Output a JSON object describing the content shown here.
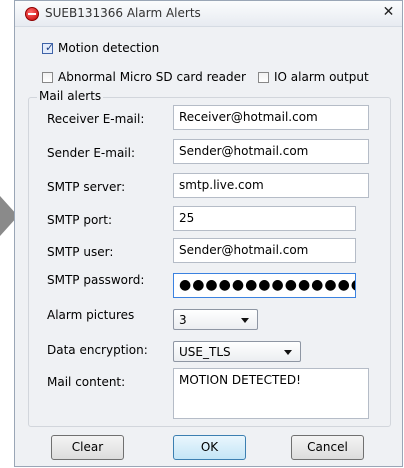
{
  "window": {
    "title": "SUEB131366 Alarm Alerts",
    "close_glyph": "✕"
  },
  "options": {
    "motion_detection": {
      "label": "Motion detection",
      "checked": true
    },
    "sd_card_reader": {
      "label": "Abnormal Micro SD card reader",
      "checked": false
    },
    "io_alarm_output": {
      "label": "IO alarm output",
      "checked": false
    }
  },
  "mail_alerts": {
    "group_label": "Mail alerts",
    "receiver_email": {
      "label": "Receiver E-mail:",
      "value": "Receiver@hotmail.com"
    },
    "sender_email": {
      "label": "Sender E-mail:",
      "value": "Sender@hotmail.com"
    },
    "smtp_server": {
      "label": "SMTP server:",
      "value": "smtp.live.com"
    },
    "smtp_port": {
      "label": "SMTP port:",
      "value": "25"
    },
    "smtp_user": {
      "label": "SMTP user:",
      "value": "Sender@hotmail.com"
    },
    "smtp_password": {
      "label": "SMTP password:",
      "value": "●●●●●●●●●●●●●●"
    },
    "alarm_pictures": {
      "label": "Alarm pictures",
      "selected": "3"
    },
    "data_encryption": {
      "label": "Data encryption:",
      "selected": "USE_TLS"
    },
    "mail_content": {
      "label": "Mail content:",
      "value": "MOTION DETECTED!"
    }
  },
  "buttons": {
    "clear": "Clear",
    "ok": "OK",
    "cancel": "Cancel"
  },
  "icons": {
    "app": "alarm-icon",
    "close": "close-icon",
    "check": "checkmark-icon"
  },
  "colors": {
    "accent": "#3b82e0",
    "titlebar": "#e7ebf1",
    "dialog_bg": "#eff1f4"
  }
}
